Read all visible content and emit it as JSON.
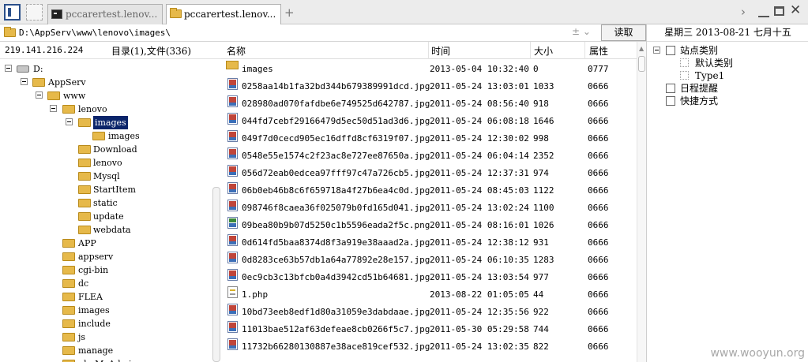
{
  "tabs": [
    {
      "label": "pccarertest.lenov...",
      "icon": "terminal-icon",
      "active": false
    },
    {
      "label": "pccarertest.lenov...",
      "icon": "folder-icon",
      "active": true
    }
  ],
  "add_tab": "+",
  "path": {
    "value": "D:\\AppServ\\www\\lenovo\\images\\",
    "arrows": "± ⌄",
    "read_button": "读取"
  },
  "info": {
    "ip": "219.141.216.224",
    "counts": "目录(1),文件(336)"
  },
  "tree": [
    {
      "label": "D:",
      "depth": 0,
      "expanded": true,
      "type": "drive"
    },
    {
      "label": "AppServ",
      "depth": 1,
      "expanded": true
    },
    {
      "label": "www",
      "depth": 2,
      "expanded": true
    },
    {
      "label": "lenovo",
      "depth": 3,
      "expanded": true
    },
    {
      "label": "images",
      "depth": 4,
      "expanded": true,
      "selected": true
    },
    {
      "label": "images",
      "depth": 5
    },
    {
      "label": "Download",
      "depth": 4
    },
    {
      "label": "lenovo",
      "depth": 4
    },
    {
      "label": "Mysql",
      "depth": 4
    },
    {
      "label": "StartItem",
      "depth": 4
    },
    {
      "label": "static",
      "depth": 4
    },
    {
      "label": "update",
      "depth": 4
    },
    {
      "label": "webdata",
      "depth": 4
    },
    {
      "label": "APP",
      "depth": 3
    },
    {
      "label": "appserv",
      "depth": 3
    },
    {
      "label": "cgi-bin",
      "depth": 3
    },
    {
      "label": "dc",
      "depth": 3
    },
    {
      "label": "FLEA",
      "depth": 3
    },
    {
      "label": "images",
      "depth": 3
    },
    {
      "label": "include",
      "depth": 3
    },
    {
      "label": "js",
      "depth": 3
    },
    {
      "label": "manage",
      "depth": 3
    },
    {
      "label": "phpMyAdmin",
      "depth": 3
    }
  ],
  "list": {
    "headers": {
      "name": "名称",
      "time": "时间",
      "size": "大小",
      "attr": "属性"
    },
    "rows": [
      {
        "name": "images",
        "time": "2013-05-04 10:32:40",
        "size": "0",
        "attr": "0777",
        "kind": "folder"
      },
      {
        "name": "0258aa14b1fa32bd344b679389991dcd.jpg",
        "time": "2011-05-24 13:03:01",
        "size": "1033",
        "attr": "0666",
        "kind": "img"
      },
      {
        "name": "028980ad070fafdbe6e749525d642787.jpg",
        "time": "2011-05-24 08:56:40",
        "size": "918",
        "attr": "0666",
        "kind": "img"
      },
      {
        "name": "044fd7cebf29166479d5ec50d51ad3d6.jpg",
        "time": "2011-05-24 06:08:18",
        "size": "1646",
        "attr": "0666",
        "kind": "img"
      },
      {
        "name": "049f7d0cecd905ec16dffd8cf6319f07.jpg",
        "time": "2011-05-24 12:30:02",
        "size": "998",
        "attr": "0666",
        "kind": "img"
      },
      {
        "name": "0548e55e1574c2f23ac8e727ee87650a.jpg",
        "time": "2011-05-24 06:04:14",
        "size": "2352",
        "attr": "0666",
        "kind": "img"
      },
      {
        "name": "056d72eab0edcea97fff97c47a726cb5.jpg",
        "time": "2011-05-24 12:37:31",
        "size": "974",
        "attr": "0666",
        "kind": "img"
      },
      {
        "name": "06b0eb46b8c6f659718a4f27b6ea4c0d.jpg",
        "time": "2011-05-24 08:45:03",
        "size": "1122",
        "attr": "0666",
        "kind": "img"
      },
      {
        "name": "098746f8caea36f025079b0fd165d041.jpg",
        "time": "2011-05-24 13:02:24",
        "size": "1100",
        "attr": "0666",
        "kind": "img"
      },
      {
        "name": "09bea80b9b07d5250c1b5596eada2f5c.png",
        "time": "2011-05-24 08:16:01",
        "size": "1026",
        "attr": "0666",
        "kind": "png"
      },
      {
        "name": "0d614fd5baa8374d8f3a919e38aaad2a.jpg",
        "time": "2011-05-24 12:38:12",
        "size": "931",
        "attr": "0666",
        "kind": "img"
      },
      {
        "name": "0d8283ce63b57db1a64a77892e28e157.jpg",
        "time": "2011-05-24 06:10:35",
        "size": "1283",
        "attr": "0666",
        "kind": "img"
      },
      {
        "name": "0ec9cb3c13bfcb0a4d3942cd51b64681.jpg",
        "time": "2011-05-24 13:03:54",
        "size": "977",
        "attr": "0666",
        "kind": "img"
      },
      {
        "name": "1.php",
        "time": "2013-08-22 01:05:05",
        "size": "44",
        "attr": "0666",
        "kind": "php"
      },
      {
        "name": "10bd73eeb8edf1d80a31059e3dabdaae.jpg",
        "time": "2011-05-24 12:35:56",
        "size": "922",
        "attr": "0666",
        "kind": "img"
      },
      {
        "name": "11013bae512af63defeae8cb0266f5c7.jpg",
        "time": "2011-05-30 05:29:58",
        "size": "744",
        "attr": "0666",
        "kind": "img"
      },
      {
        "name": "11732b66280130887e38ace819cef532.jpg",
        "time": "2011-05-24 13:02:35",
        "size": "822",
        "attr": "0666",
        "kind": "img"
      }
    ]
  },
  "right_panel": {
    "date": "星期三  2013-08-21  七月十五",
    "items": [
      {
        "label": "站点类别",
        "depth": 0,
        "expander": true,
        "icon": "category-icon"
      },
      {
        "label": "默认类别",
        "depth": 1,
        "icon": "checkbox-icon"
      },
      {
        "label": "Type1",
        "depth": 1,
        "icon": "checkbox-icon"
      },
      {
        "label": "日程提醒",
        "depth": 0,
        "icon": "calendar-icon"
      },
      {
        "label": "快捷方式",
        "depth": 0,
        "icon": "shortcut-icon"
      }
    ]
  },
  "watermark": "www.wooyun.org"
}
